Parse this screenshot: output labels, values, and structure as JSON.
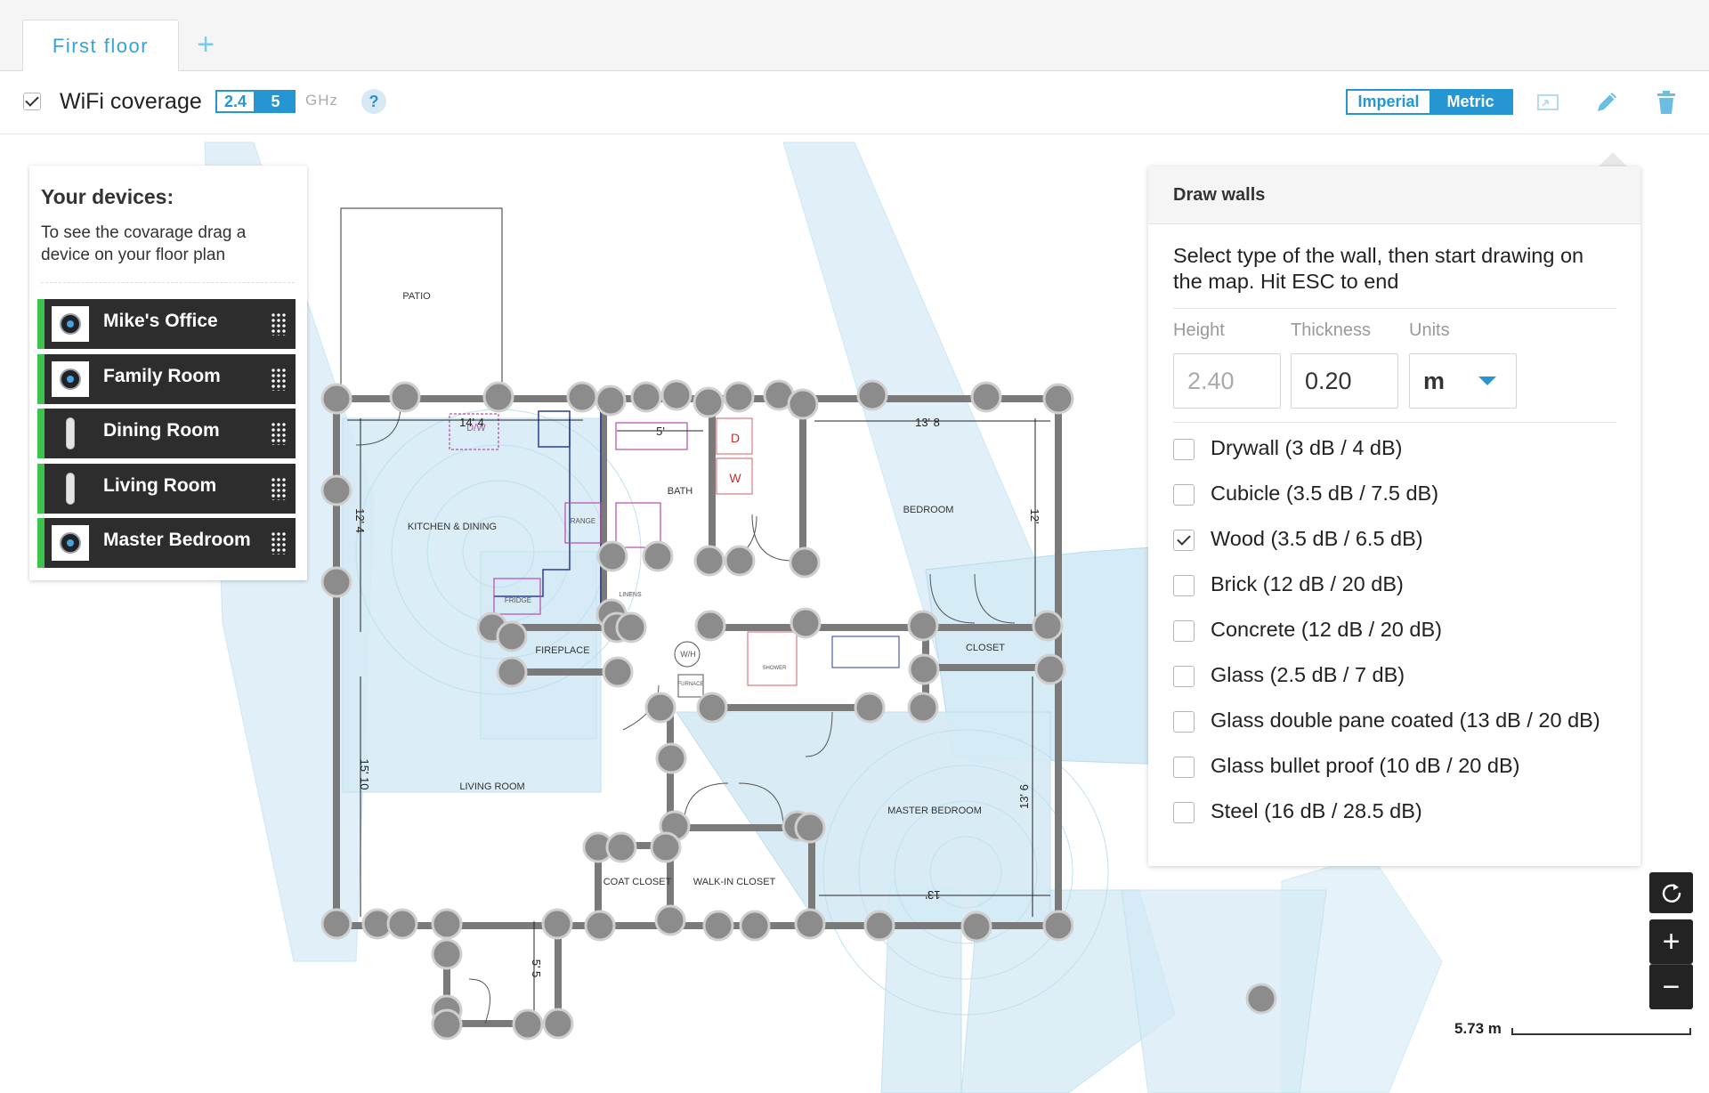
{
  "tabs": [
    {
      "label": "First floor"
    }
  ],
  "tab_add_label": "+",
  "toolbar": {
    "wifi_label": "WiFi coverage",
    "wifi_checked": true,
    "band_24": "2.4",
    "band_5": "5",
    "ghz": "GHz",
    "help": "?",
    "imperial": "Imperial",
    "metric": "Metric",
    "icons": [
      "resize-icon",
      "pencil-icon",
      "trash-icon"
    ]
  },
  "devices_panel": {
    "title": "Your devices:",
    "help": "To see the covarage drag a device on your floor plan",
    "devices": [
      {
        "name": "Mike's Office",
        "icon": "round-router-icon"
      },
      {
        "name": "Family Room",
        "icon": "round-router-icon"
      },
      {
        "name": "Dining Room",
        "icon": "tall-router-icon"
      },
      {
        "name": "Living Room",
        "icon": "tall-router-icon"
      },
      {
        "name": "Master Bedroom",
        "icon": "round-router-icon"
      }
    ]
  },
  "draw_walls": {
    "title": "Draw walls",
    "description": "Select type of the wall, then start drawing on the map. Hit ESC to end",
    "height_label": "Height",
    "height_value": "2.40",
    "thickness_label": "Thickness",
    "thickness_value": "0.20",
    "units_label": "Units",
    "units_value": "m",
    "wall_types": [
      {
        "label": "Drywall (3 dB / 4 dB)",
        "checked": false
      },
      {
        "label": "Cubicle (3.5 dB / 7.5 dB)",
        "checked": false
      },
      {
        "label": "Wood (3.5 dB / 6.5 dB)",
        "checked": true
      },
      {
        "label": "Brick (12 dB / 20 dB)",
        "checked": false
      },
      {
        "label": "Concrete (12 dB / 20 dB)",
        "checked": false
      },
      {
        "label": "Glass (2.5 dB / 7 dB)",
        "checked": false
      },
      {
        "label": "Glass double pane coated (13 dB / 20 dB)",
        "checked": false
      },
      {
        "label": "Glass bullet proof (10 dB / 20 dB)",
        "checked": false
      },
      {
        "label": "Steel (16 dB / 28.5 dB)",
        "checked": false
      }
    ]
  },
  "floorplan": {
    "rooms": [
      "PATIO",
      "KITCHEN & DINING",
      "BATH",
      "BEDROOM",
      "FIREPLACE",
      "CLOSET",
      "LIVING ROOM",
      "MASTER BEDROOM",
      "COAT CLOSET",
      "WALK-IN CLOSET"
    ],
    "fixtures": [
      "D/W",
      "D",
      "W",
      "RANGE",
      "FRIDGE",
      "LINENS",
      "W/H",
      "FURNACE",
      "SHOWER"
    ],
    "dimensions": [
      "14' 4",
      "5'",
      "13' 8",
      "12' 4",
      "12'",
      "15' 10",
      "13' 6",
      "13'",
      "5' 5"
    ]
  },
  "map_controls": {
    "reset": "reset-icon",
    "zoom_in": "+",
    "zoom_out": "−"
  },
  "scale": {
    "label": "5.73 m"
  },
  "colors": {
    "accent": "#2596d1",
    "coverage": "#cfe8f4",
    "device_active": "#3bc44b",
    "wall": "#7a7a7a",
    "node": "#8a8a8a"
  }
}
